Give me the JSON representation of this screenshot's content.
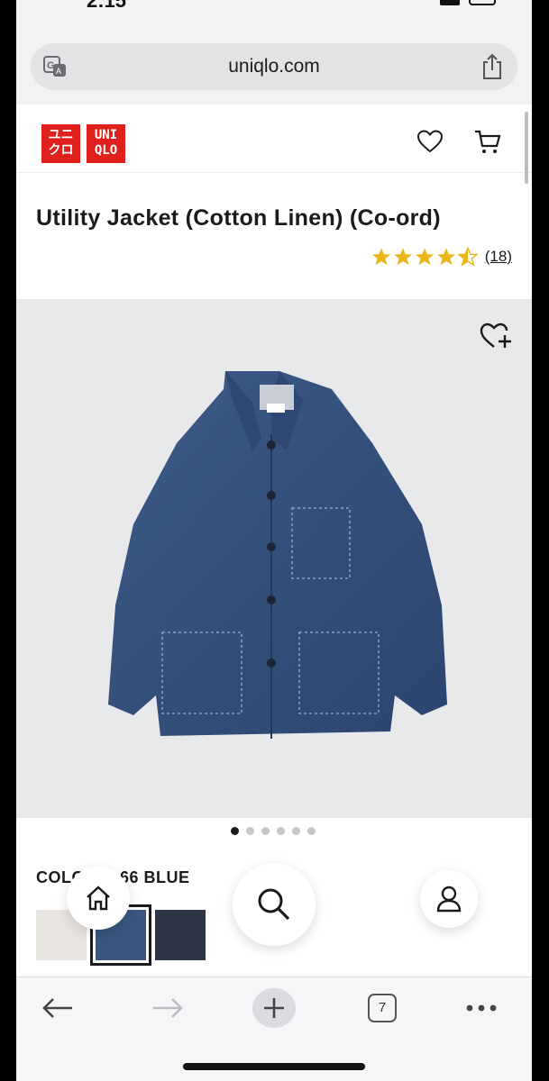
{
  "status_bar": {
    "time": "2:15"
  },
  "browser": {
    "url": "uniqlo.com",
    "tabs_count": "7"
  },
  "brand": {
    "logo_line1": "ユニ",
    "logo_line2": "クロ",
    "logo_right_line1": "UNI",
    "logo_right_line2": "QLO",
    "accent_color": "#e0201c"
  },
  "product": {
    "title": "Utility Jacket (Cotton Linen) (Co-ord)",
    "rating": 4.5,
    "review_count": "(18)",
    "colour_label": "COLOUR: 66 BLUE",
    "image_dots": [
      true,
      false,
      false,
      false,
      false,
      false
    ],
    "swatches": [
      {
        "name": "off-white",
        "color": "#e8e4df",
        "selected": false
      },
      {
        "name": "blue",
        "color": "#3b5680",
        "selected": true
      },
      {
        "name": "navy",
        "color": "#2d3444",
        "selected": false
      }
    ]
  }
}
